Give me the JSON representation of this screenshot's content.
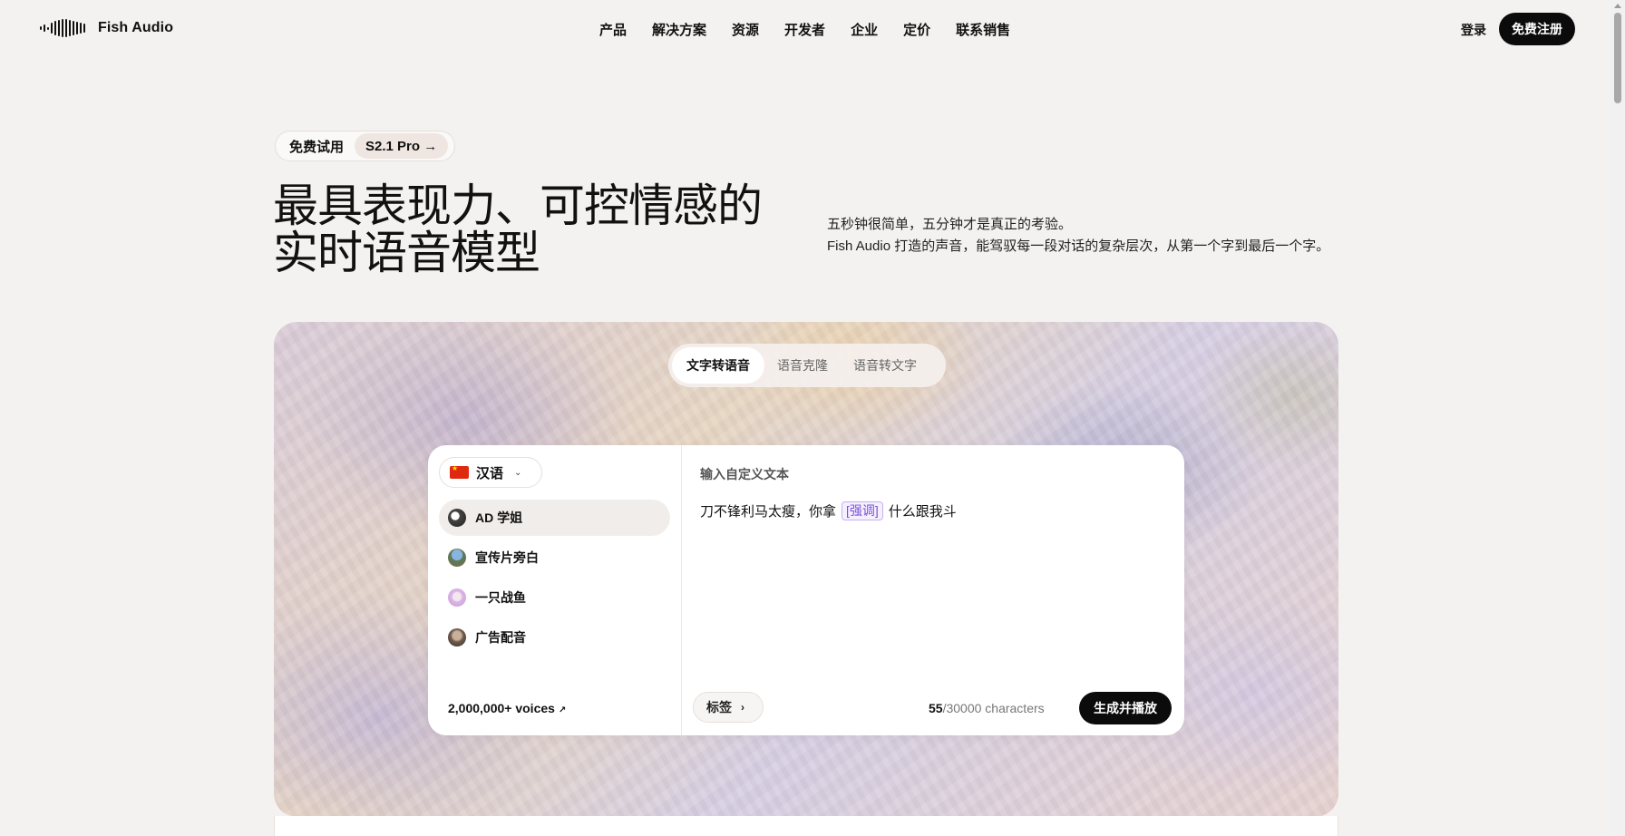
{
  "brand": {
    "name": "Fish Audio"
  },
  "nav": {
    "menu": [
      "产品",
      "解决方案",
      "资源",
      "开发者",
      "企业",
      "定价",
      "联系销售"
    ],
    "login": "登录",
    "signup": "免费注册"
  },
  "hero": {
    "trial_label": "免费试用",
    "model_link": "S2.1 Pro →",
    "title_line1": "最具表现力、可控情感的",
    "title_line2": "实时语音模型",
    "desc_line1": "五秒钟很简单，五分钟才是真正的考验。",
    "desc_line2": "Fish Audio 打造的声音，能驾驭每一段对话的复杂层次，从第一个字到最后一个字。"
  },
  "demo": {
    "tabs": [
      "文字转语音",
      "语音克隆",
      "语音转文字"
    ],
    "active_tab": 0,
    "language": "汉语",
    "voices": [
      {
        "name": "AD 学姐",
        "avatar": "anime-girl-avatar",
        "active": true
      },
      {
        "name": "宣传片旁白",
        "avatar": "landscape-avatar",
        "active": false
      },
      {
        "name": "一只战鱼",
        "avatar": "pink-character-avatar",
        "active": false
      },
      {
        "name": "广告配音",
        "avatar": "portrait-avatar",
        "active": false
      }
    ],
    "voices_count": "2,000,000+ voices",
    "input_label": "输入自定义文本",
    "text_before": "刀不锋利马太瘦，你拿",
    "text_tag": "[强调]",
    "text_after": "什么跟我斗",
    "tags_button": "标签",
    "char_current": "55",
    "char_rest": "/30000 characters",
    "generate_button": "生成并播放"
  },
  "colors": {
    "accent": "#0b0b0b",
    "tag": "#7b50d8",
    "background": "#f4f2f0"
  }
}
